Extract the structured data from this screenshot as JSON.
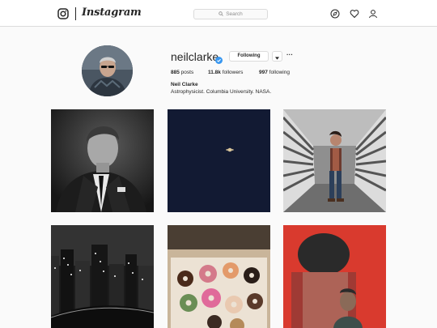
{
  "nav": {
    "brand_icon": "instagram-camera-icon",
    "wordmark": "Instagram",
    "search_placeholder": "Search",
    "icons": [
      "compass-icon",
      "heart-icon",
      "user-icon"
    ]
  },
  "profile": {
    "username": "neilclarke",
    "verified": true,
    "follow_label": "Following",
    "posts_count": "885",
    "posts_label": "posts",
    "followers_count": "11.8k",
    "followers_label": "followers",
    "following_count": "997",
    "following_label": "following",
    "full_name": "Neil Clarke",
    "bio": "Astrophysicist. Columbia University. NASA."
  },
  "colors": {
    "verified_blue": "#3897f0",
    "border": "#dbdbdb",
    "background": "#fafafa"
  },
  "grid": {
    "posts": [
      "man-in-suit-portrait",
      "saturn-in-night-sky",
      "man-in-light-tunnel",
      "night-city-skyline",
      "box-of-donuts",
      "man-under-red-shadow"
    ]
  }
}
